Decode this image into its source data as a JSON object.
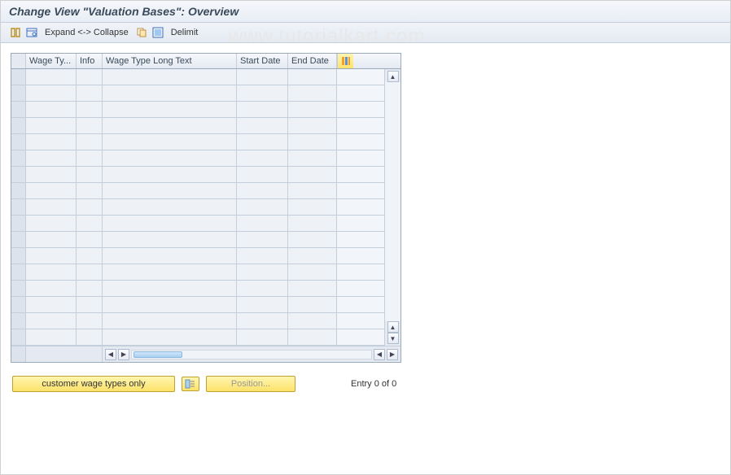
{
  "watermark": "www.tutorialkart.com",
  "title": "Change View \"Valuation Bases\": Overview",
  "toolbar": {
    "expand_collapse": "Expand <-> Collapse",
    "delimit": "Delimit"
  },
  "grid": {
    "columns": {
      "wage_type": "Wage Ty...",
      "info": "Info",
      "long_text": "Wage Type Long Text",
      "start_date": "Start Date",
      "end_date": "End Date"
    },
    "row_count": 17
  },
  "buttons": {
    "customer_wt": "customer wage types only",
    "position": "Position..."
  },
  "status": {
    "entry": "Entry 0 of 0"
  }
}
